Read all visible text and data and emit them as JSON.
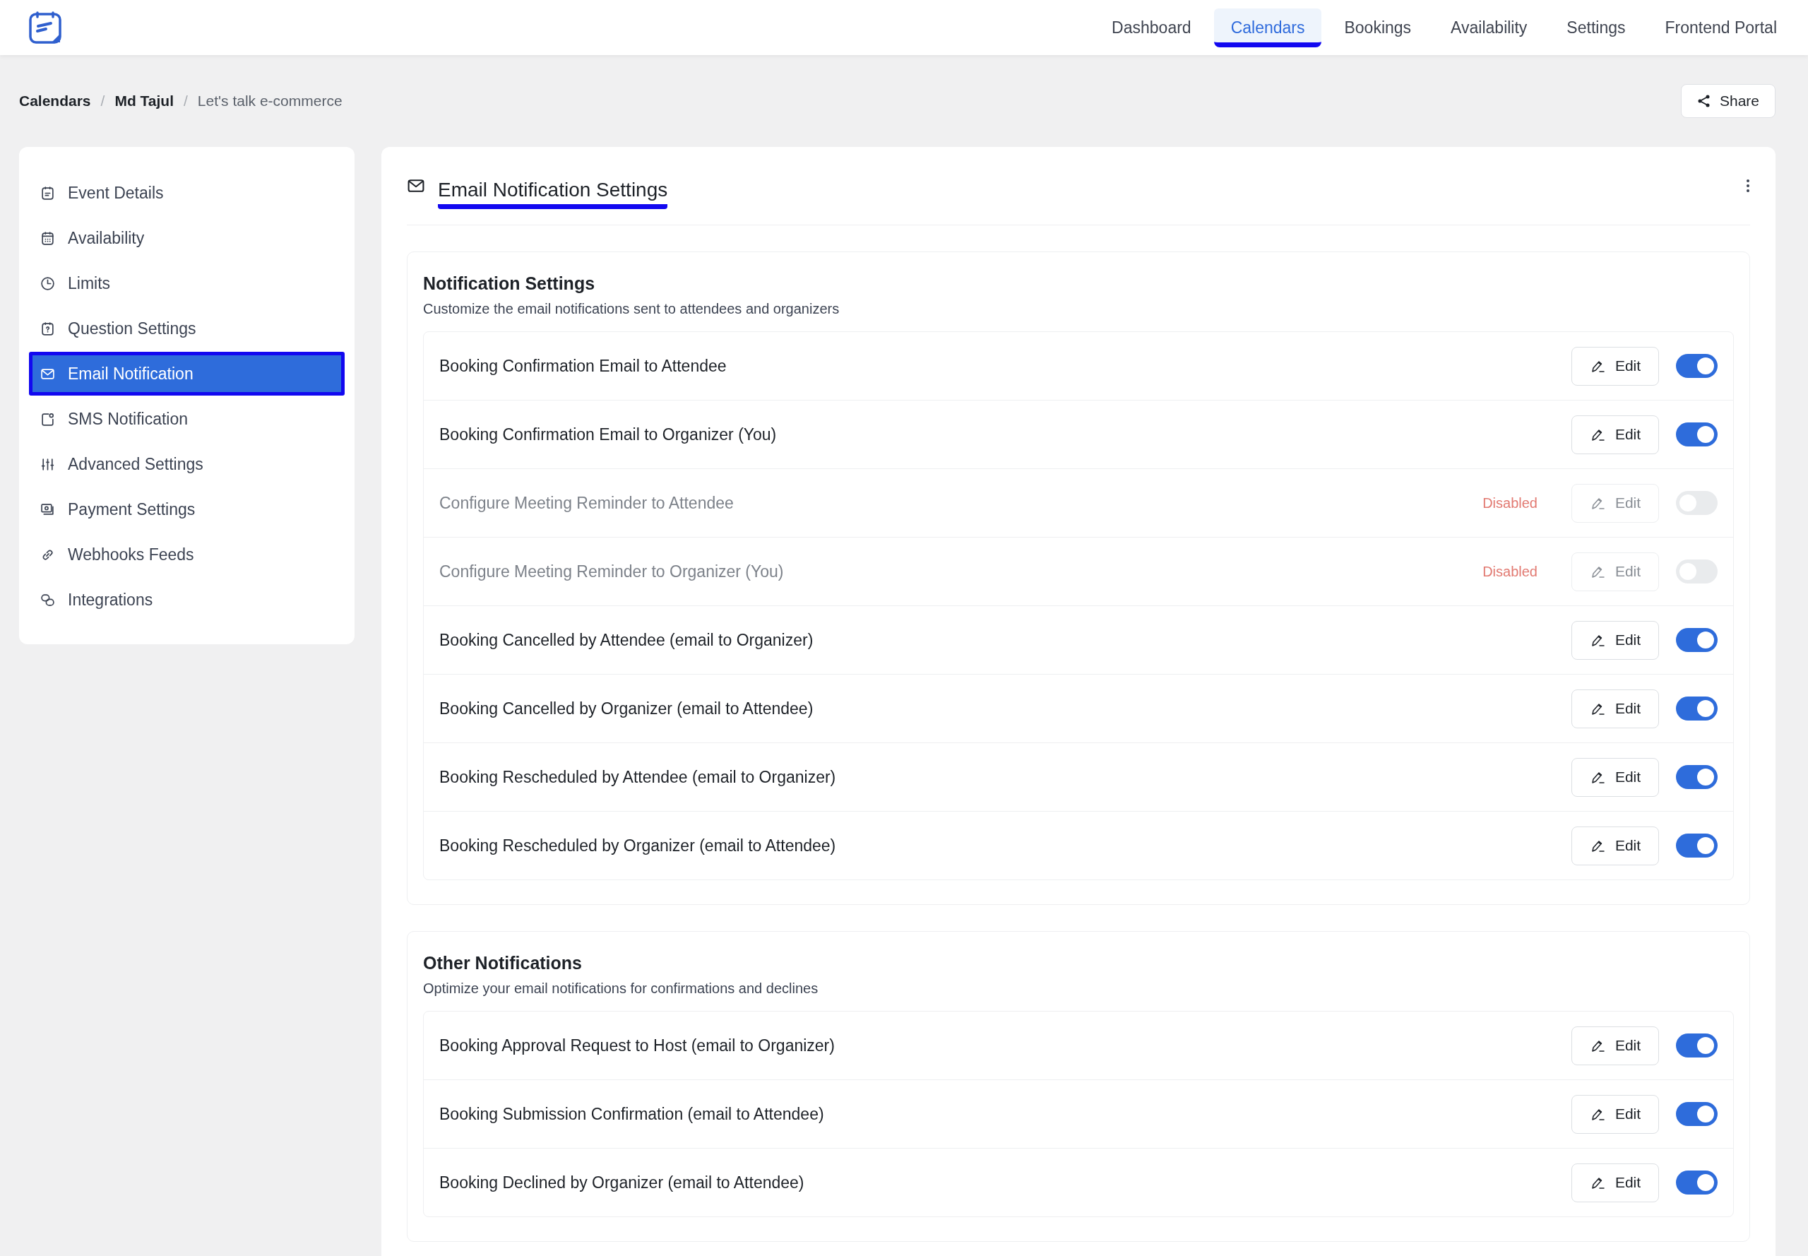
{
  "nav": [
    {
      "label": "Dashboard",
      "selected": false
    },
    {
      "label": "Calendars",
      "selected": true
    },
    {
      "label": "Bookings",
      "selected": false
    },
    {
      "label": "Availability",
      "selected": false
    },
    {
      "label": "Settings",
      "selected": false
    },
    {
      "label": "Frontend Portal",
      "selected": false
    }
  ],
  "breadcrumb": [
    {
      "label": "Calendars",
      "current": false
    },
    {
      "label": "Md Tajul",
      "current": false
    },
    {
      "label": "Let's talk e-commerce",
      "current": true
    }
  ],
  "breadcrumb_separator": "/",
  "share_button": "Share",
  "sidebar": {
    "items": [
      {
        "label": "Event Details",
        "kind": "event",
        "selected": false
      },
      {
        "label": "Availability",
        "kind": "calendar",
        "selected": false
      },
      {
        "label": "Limits",
        "kind": "clock",
        "selected": false
      },
      {
        "label": "Question Settings",
        "kind": "question",
        "selected": false
      },
      {
        "label": "Email Notification",
        "kind": "mail",
        "selected": true
      },
      {
        "label": "SMS Notification",
        "kind": "sms",
        "selected": false
      },
      {
        "label": "Advanced Settings",
        "kind": "sliders",
        "selected": false
      },
      {
        "label": "Payment Settings",
        "kind": "payment",
        "selected": false
      },
      {
        "label": "Webhooks Feeds",
        "kind": "link",
        "selected": false
      },
      {
        "label": "Integrations",
        "kind": "integrations",
        "selected": false
      }
    ]
  },
  "panel": {
    "title": "Email Notification Settings"
  },
  "sections": [
    {
      "title": "Notification Settings",
      "description": "Customize the email notifications sent to attendees and organizers",
      "rows": [
        {
          "label": "Booking Confirmation Email to Attendee",
          "disabled": false,
          "on": true,
          "edit": "Edit"
        },
        {
          "label": "Booking Confirmation Email to Organizer (You)",
          "disabled": false,
          "on": true,
          "edit": "Edit"
        },
        {
          "label": "Configure Meeting Reminder to Attendee",
          "disabled": true,
          "status": "Disabled",
          "on": false,
          "edit": "Edit"
        },
        {
          "label": "Configure Meeting Reminder to Organizer (You)",
          "disabled": true,
          "status": "Disabled",
          "on": false,
          "edit": "Edit"
        },
        {
          "label": "Booking Cancelled by Attendee (email to Organizer)",
          "disabled": false,
          "on": true,
          "edit": "Edit"
        },
        {
          "label": "Booking Cancelled by Organizer (email to Attendee)",
          "disabled": false,
          "on": true,
          "edit": "Edit"
        },
        {
          "label": "Booking Rescheduled by Attendee (email to Organizer)",
          "disabled": false,
          "on": true,
          "edit": "Edit"
        },
        {
          "label": "Booking Rescheduled by Organizer (email to Attendee)",
          "disabled": false,
          "on": true,
          "edit": "Edit"
        }
      ]
    },
    {
      "title": "Other Notifications",
      "description": "Optimize your email notifications for confirmations and declines",
      "rows": [
        {
          "label": "Booking Approval Request to Host (email to Organizer)",
          "disabled": false,
          "on": true,
          "edit": "Edit"
        },
        {
          "label": "Booking Submission Confirmation (email to Attendee)",
          "disabled": false,
          "on": true,
          "edit": "Edit"
        },
        {
          "label": "Booking Declined by Organizer (email to Attendee)",
          "disabled": false,
          "on": true,
          "edit": "Edit"
        }
      ]
    }
  ]
}
